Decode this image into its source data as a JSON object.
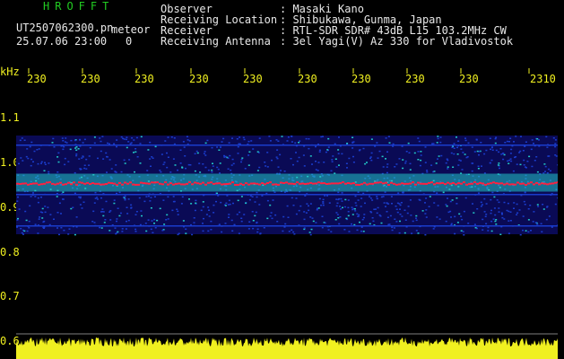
{
  "header": {
    "brand": "HROFFT",
    "filename": "UT2507062300.pn",
    "mode": "meteor",
    "datetime": "25.07.06 23:00",
    "count": "0",
    "info": [
      {
        "label": "Observer",
        "value": ": Masaki Kano"
      },
      {
        "label": "Receiving Location",
        "value": ": Shibukawa, Gunma, Japan"
      },
      {
        "label": "Receiver",
        "value": ": RTL-SDR SDR# 43dB L15 103.2MHz CW"
      },
      {
        "label": "Receiving Antenna",
        "value": ": 3el Yagi(V) Az 330 for Vladivostok"
      }
    ]
  },
  "axis": {
    "unit": "kHz",
    "time_ticks": [
      "230",
      "230",
      "230",
      "230",
      "230",
      "230",
      "230",
      "230",
      "230",
      "2310"
    ],
    "freq_ticks": [
      {
        "label": "1.1",
        "value": 1.1
      },
      {
        "label": "1.0",
        "value": 1.0
      },
      {
        "label": "0.9",
        "value": 0.9
      },
      {
        "label": "0.8",
        "value": 0.8
      },
      {
        "label": "0.7",
        "value": 0.7
      },
      {
        "label": "0.6",
        "value": 0.6
      }
    ]
  },
  "colors": {
    "background": "#000000",
    "noise_low": "#0a0a55",
    "noise_mid": "#1a3ccc",
    "noise_high": "#22c8c8",
    "signal": "#ff2040",
    "level_bar": "#f0f020",
    "tick_text": "#f0f020",
    "header_text": "#e8e8e8",
    "brand_text": "#22cc22"
  }
}
